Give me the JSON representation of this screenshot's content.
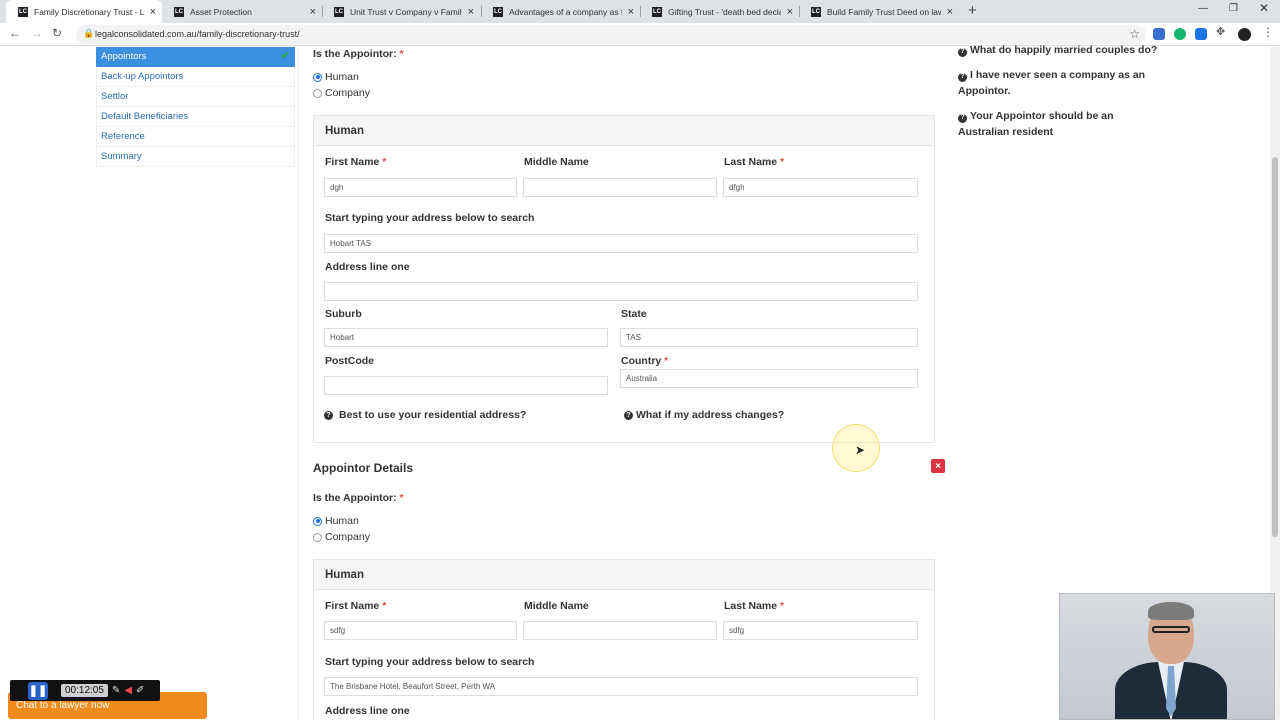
{
  "browser": {
    "tabs": [
      {
        "title": "Family Discretionary Trust - Lega",
        "active": true
      },
      {
        "title": "Asset Protection",
        "active": false
      },
      {
        "title": "Unit Trust v Company v Family Tr",
        "active": false
      },
      {
        "title": "Advantages of a company as trus",
        "active": false
      },
      {
        "title": "Gifting Trust - 'death bed declar",
        "active": false
      },
      {
        "title": "Build Family Trust Deed on law fi",
        "active": false
      }
    ],
    "favicon_text": "LC",
    "url": "legalconsolidated.com.au/family-discretionary-trust/"
  },
  "sidebar": {
    "items": [
      {
        "label": "Appointors",
        "active": true
      },
      {
        "label": "Back-up Appointors",
        "active": false
      },
      {
        "label": "Settlor",
        "active": false
      },
      {
        "label": "Default Beneficiaries",
        "active": false
      },
      {
        "label": "Reference",
        "active": false
      },
      {
        "label": "Summary",
        "active": false
      }
    ]
  },
  "appointor1": {
    "question": "Is the Appointor:",
    "required_mark": "*",
    "options": [
      "Human",
      "Company"
    ],
    "selected": "Human",
    "panel_title": "Human",
    "first_name_label": "First Name",
    "middle_name_label": "Middle Name",
    "last_name_label": "Last Name",
    "first_name": "dgh",
    "middle_name": "",
    "last_name": "dfgh",
    "address_search_label": "Start typing your address below to search",
    "address_search": "Hobart TAS",
    "address_line_label": "Address line one",
    "address_line": "",
    "suburb_label": "Suburb",
    "suburb": "Hobart",
    "state_label": "State",
    "state": "TAS",
    "postcode_label": "PostCode",
    "postcode": "",
    "country_label": "Country",
    "country": "Australia",
    "help1": "Best to use your residential address?",
    "help2": "What if my address changes?"
  },
  "appointor2": {
    "section_title": "Appointor Details",
    "delete_glyph": "×",
    "question": "Is the Appointor:",
    "required_mark": "*",
    "options": [
      "Human",
      "Company"
    ],
    "selected": "Human",
    "panel_title": "Human",
    "first_name_label": "First Name",
    "middle_name_label": "Middle Name",
    "last_name_label": "Last Name",
    "first_name": "sdfg",
    "middle_name": "",
    "last_name": "sdfg",
    "address_search_label": "Start typing your address below to search",
    "address_search": "The Brisbane Hotel, Beaufort Street, Perth WA",
    "address_line_label": "Address line one"
  },
  "right_help": [
    "What do happily married couples do?",
    "I have never seen a company as an Appointor.",
    "Your Appointor should be an Australian resident"
  ],
  "chat": {
    "label": "Chat to a lawyer now"
  },
  "recorder": {
    "time": "00:12:05"
  },
  "colors": {
    "sidebar_active": "#3b8fdf",
    "required": "#d9534f",
    "chat": "#f08a1a",
    "delete": "#d9343f"
  }
}
